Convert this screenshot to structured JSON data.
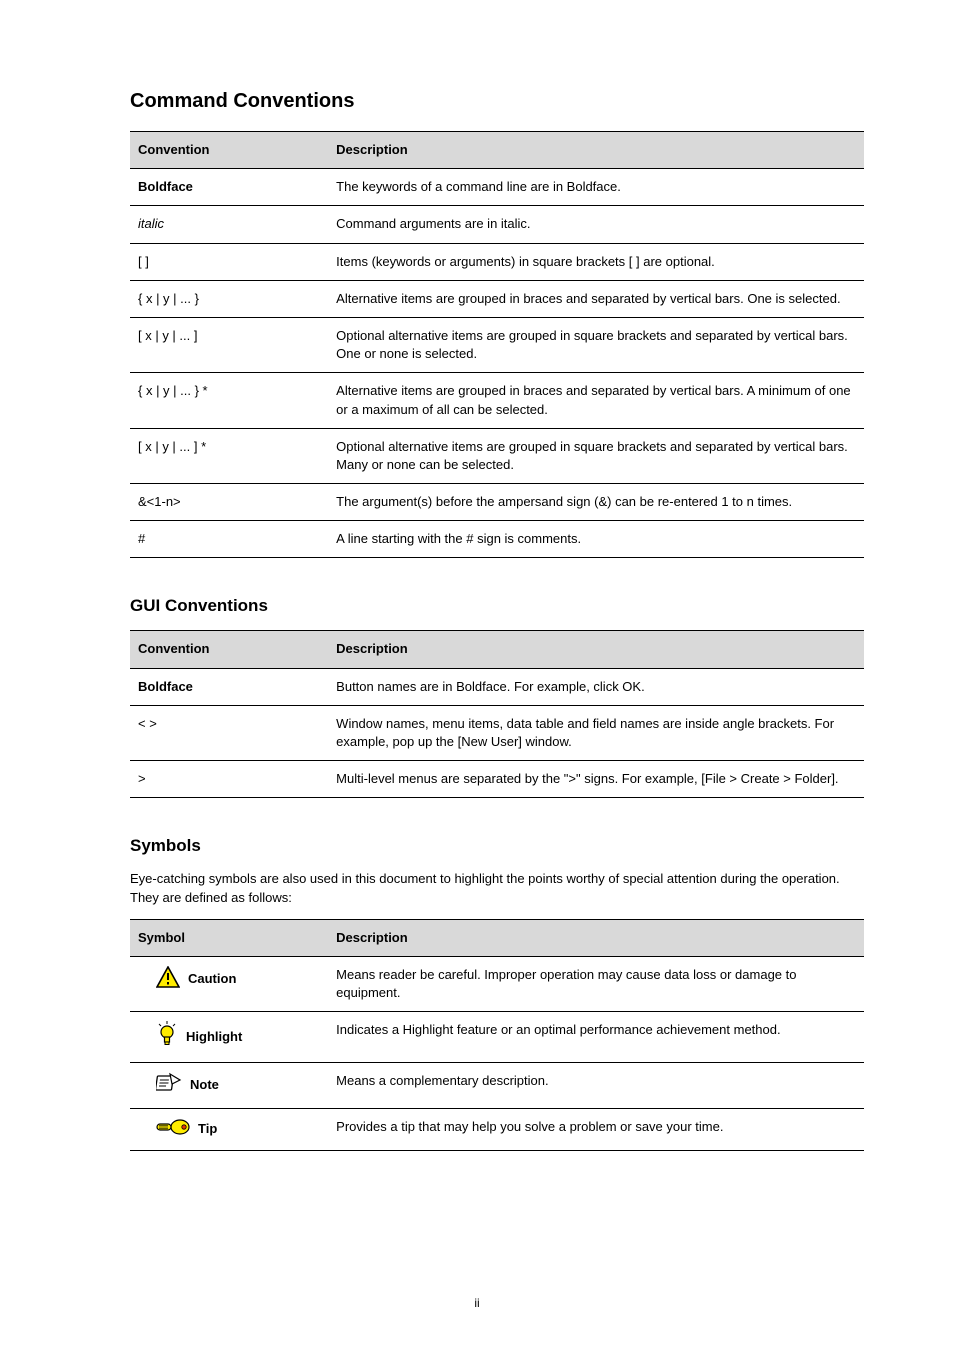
{
  "section1": {
    "title": "Command Conventions",
    "tableHeaders": {
      "left": "Convention",
      "right": "Description"
    },
    "rows": [
      {
        "conv": "Boldface",
        "conv_class": "bold",
        "desc": "The keywords of a command line are in Boldface."
      },
      {
        "conv": "italic",
        "conv_class": "italic",
        "desc": "Command arguments are in italic."
      },
      {
        "conv": "[ ]",
        "desc": "Items (keywords or arguments) in square brackets [ ] are optional."
      },
      {
        "conv": "{ x | y | ... }",
        "desc": "Alternative items are grouped in braces and separated by vertical bars. One is selected."
      },
      {
        "conv": "[ x | y | ... ]",
        "desc": "Optional alternative items are grouped in square brackets and separated by vertical bars. One or none is selected."
      },
      {
        "conv": "{ x | y | ... } *",
        "desc": "Alternative items are grouped in braces and separated by vertical bars. A minimum of one or a maximum of all can be selected."
      },
      {
        "conv": "[ x | y | ... ] *",
        "desc": "Optional alternative items are grouped in square brackets and separated by vertical bars. Many or none can be selected."
      },
      {
        "conv": "&<1-n>",
        "desc": "The argument(s) before the ampersand sign (&) can be re-entered 1 to n times."
      },
      {
        "conv": "#",
        "desc": "A line starting with the # sign is comments."
      }
    ]
  },
  "section2": {
    "title": "GUI Conventions",
    "tableHeaders": {
      "left": "Convention",
      "right": "Description"
    },
    "rows": [
      {
        "conv": "Boldface",
        "conv_class": "bold",
        "desc": "Button names are in Boldface. For example, click OK."
      },
      {
        "conv": "Window names, menu items, data table and field names are inside angle brackets. For example, pop up the [New User] window.",
        "conv_angle": "< >"
      },
      {
        "conv": ">",
        "desc": "Multi-level menus are separated by the \">\" signs. For example, [File > Create > Folder]."
      }
    ]
  },
  "section3": {
    "title": "Symbols",
    "description": "Eye-catching symbols are also used in this document to highlight the points worthy of special attention during the operation. They are defined as follows:",
    "tableHeaders": {
      "left": "Symbol",
      "right": "Description"
    },
    "rows": [
      {
        "label": "Caution",
        "icon": "caution",
        "desc": "Means reader be careful. Improper operation may cause data loss or damage to equipment."
      },
      {
        "label": "Highlight",
        "icon": "highlight",
        "desc": "Indicates a Highlight feature or an optimal performance achievement method."
      },
      {
        "label": "Note",
        "icon": "note",
        "desc": "Means a complementary description."
      },
      {
        "label": "Tip",
        "icon": "tip",
        "desc": "Provides a tip that may help you solve a problem or save your time."
      }
    ]
  },
  "footer": {
    "page": "ii"
  }
}
